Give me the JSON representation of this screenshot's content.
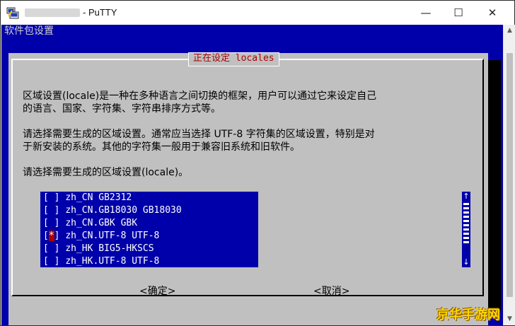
{
  "window": {
    "title": "PuTTY",
    "controls": {
      "minimize": "—",
      "maximize": "☐",
      "close": "✕"
    }
  },
  "screen": {
    "title": "软件包设置"
  },
  "dialog": {
    "title": "正在设定 locales",
    "paragraph1_line1": "区域设置(locale)是一种在多种语言之间切换的框架，用户可以通过它来设定自己",
    "paragraph1_line2": "的语言、国家、字符集、字符串排序方式等。",
    "paragraph2_line1": "请选择需要生成的区域设置。通常应当选择 UTF-8 字符集的区域设置，特别是对",
    "paragraph2_line2": "于新安装的系统。其他的字符集一般用于兼容旧系统和旧软件。",
    "prompt": "请选择需要生成的区域设置(locale)。",
    "items": [
      {
        "mark": " ",
        "label": "zh_CN GB2312"
      },
      {
        "mark": " ",
        "label": "zh_CN.GB18030 GB18030"
      },
      {
        "mark": " ",
        "label": "zh_CN.GBK GBK"
      },
      {
        "mark": "*",
        "label": "zh_CN.UTF-8 UTF-8"
      },
      {
        "mark": " ",
        "label": "zh_HK BIG5-HKSCS"
      },
      {
        "mark": " ",
        "label": "zh_HK.UTF-8 UTF-8"
      }
    ],
    "scroll_up": "↑",
    "scroll_down": "↓",
    "ok_label": "<确定>",
    "cancel_label": "<取消>"
  },
  "watermark": "京华手游网",
  "colors": {
    "terminal_bg": "#0000aa",
    "dialog_bg": "#c0c0c0",
    "title_red": "#aa0000",
    "selected_mark_bg": "#aa0000"
  }
}
